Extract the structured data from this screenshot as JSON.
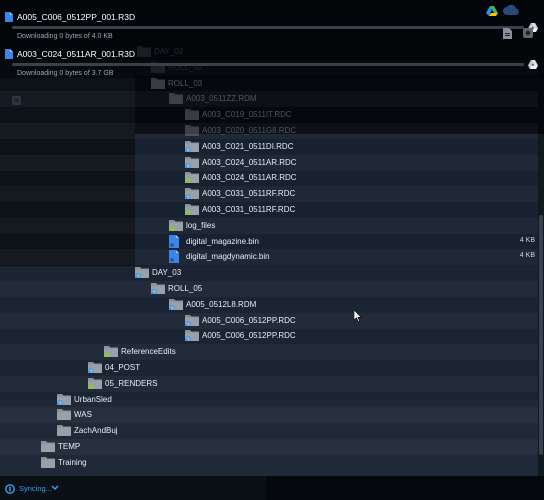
{
  "colors": {
    "folder": "#8a9099",
    "folder_tab": "#9aa0a8",
    "synced_badge": "#8bc34a",
    "syncing_badge": "#2e8be6",
    "file_blue": "#3a86e8",
    "accent": "#3aa0e8"
  },
  "downloads": [
    {
      "filename": "A005_C006_0512PP_001.R3D",
      "progress": "Downloading 0 bytes of 4.0 KB",
      "percent": 0
    },
    {
      "filename": "A003_C024_0511AR_001.R3D",
      "progress": "Downloading 0 bytes of 3.7 GB",
      "percent": 0
    }
  ],
  "tree": [
    {
      "name": "DAY_02",
      "type": "folder",
      "badge": "none",
      "dim": true
    },
    {
      "name": "ROLL_02",
      "type": "folder",
      "badge": "none",
      "dim": true
    },
    {
      "name": "ROLL_03",
      "type": "folder",
      "badge": "none",
      "dim": true
    },
    {
      "name": "A003_0511ZZ.RDM",
      "type": "folder",
      "badge": "none",
      "dim": true
    },
    {
      "name": "A003_C019_0511IT.RDC",
      "type": "folder",
      "badge": "none",
      "dim": true
    },
    {
      "name": "A003_C020_0511G8.RDC",
      "type": "folder",
      "badge": "none",
      "dim": true
    },
    {
      "name": "A003_C021_0511DI.RDC",
      "type": "folder",
      "badge": "sync"
    },
    {
      "name": "A003_C024_0511AR.RDC",
      "type": "folder",
      "badge": "sync"
    },
    {
      "name": "A003_C024_0511AR.RDC",
      "type": "folder",
      "badge": "ok"
    },
    {
      "name": "A003_C031_0511RF.RDC",
      "type": "folder",
      "badge": "sync"
    },
    {
      "name": "A003_C031_0511RF.RDC",
      "type": "folder",
      "badge": "ok"
    },
    {
      "name": "log_files",
      "type": "folder",
      "badge": "ok"
    },
    {
      "name": "digital_magazine.bin",
      "type": "file",
      "size": "4 KB"
    },
    {
      "name": "digital_magdynamic.bin",
      "type": "file",
      "size": "4 KB"
    },
    {
      "name": "DAY_03",
      "type": "folder",
      "badge": "sync"
    },
    {
      "name": "ROLL_05",
      "type": "folder",
      "badge": "sync"
    },
    {
      "name": "A005_0512L8.RDM",
      "type": "folder",
      "badge": "sync"
    },
    {
      "name": "A005_C006_0512PP.RDC",
      "type": "folder",
      "badge": "sync"
    },
    {
      "name": "A005_C006_0512PP.RDC",
      "type": "folder",
      "badge": "sync"
    },
    {
      "name": "ReferenceEdits",
      "type": "folder",
      "badge": "ok"
    },
    {
      "name": "04_POST",
      "type": "folder",
      "badge": "sync"
    },
    {
      "name": "05_RENDERS",
      "type": "folder",
      "badge": "ok"
    },
    {
      "name": "UrbanSled",
      "type": "folder",
      "badge": "sync"
    },
    {
      "name": "WAS",
      "type": "folder",
      "badge": "none"
    },
    {
      "name": "ZachAndBuj",
      "type": "folder",
      "badge": "none"
    },
    {
      "name": "TEMP",
      "type": "folder",
      "badge": "none"
    },
    {
      "name": "Training",
      "type": "folder",
      "badge": "none"
    }
  ],
  "footer": {
    "status": "Syncing..."
  }
}
